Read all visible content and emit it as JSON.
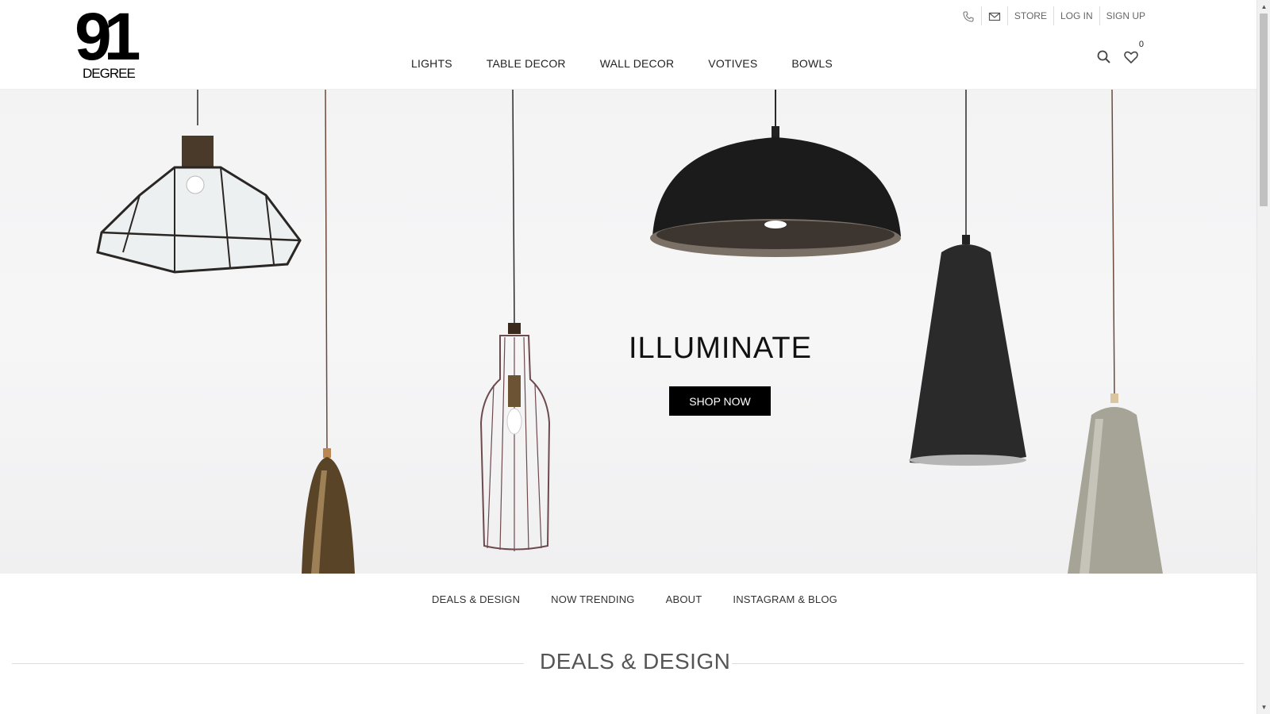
{
  "brand": {
    "logo_number": "91",
    "logo_word": "DEGREE"
  },
  "top_links": {
    "store": "STORE",
    "login": "LOG IN",
    "signup": "SIGN UP"
  },
  "main_nav": [
    "LIGHTS",
    "TABLE DECOR",
    "WALL DECOR",
    "VOTIVES",
    "BOWLS"
  ],
  "header_icons": {
    "search": "search-icon",
    "wishlist": "heart-icon",
    "wishlist_count": "0",
    "phone": "phone-icon",
    "email": "mail-icon"
  },
  "hero": {
    "title": "ILLUMINATE",
    "cta": "SHOP NOW"
  },
  "secondary_nav": [
    "DEALS & DESIGN",
    "NOW TRENDING",
    "ABOUT",
    "INSTAGRAM & BLOG"
  ],
  "section": {
    "title": "DEALS & DESIGN"
  },
  "colors": {
    "accent": "#000000",
    "text": "#222222",
    "muted": "#666666"
  }
}
